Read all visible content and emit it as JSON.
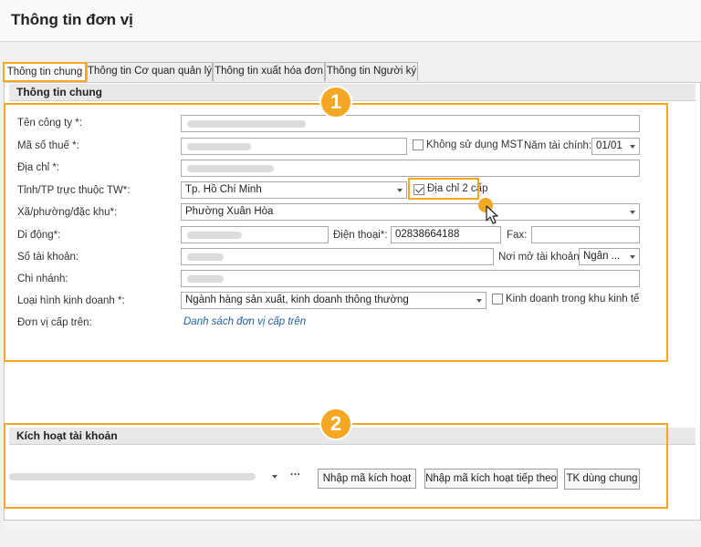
{
  "header": {
    "title": "Thông tin đơn vị"
  },
  "tabs": [
    {
      "label": "Thông tin chung",
      "active": true
    },
    {
      "label": "Thông tin Cơ quan quản lý",
      "active": false
    },
    {
      "label": "Thông tin xuất hóa đơn",
      "active": false
    },
    {
      "label": "Thông tin Người ký",
      "active": false
    }
  ],
  "general": {
    "section_title": "Thông tin chung",
    "company_name_label": "Tên công ty *:",
    "tax_code_label": "Mã số thuế *:",
    "no_tax_code_label": "Không sử dụng MST",
    "fiscal_year_label": "Năm tài chính:",
    "fiscal_year_value": "01/01",
    "address_label": "Địa chỉ *:",
    "province_label": "Tỉnh/TP trực thuộc TW*:",
    "province_value": "Tp. Hồ Chí Minh",
    "two_level_address_label": "Địa chỉ 2 cấp",
    "ward_label": "Xã/phường/đặc khu*:",
    "ward_value": "Phường Xuân Hòa",
    "mobile_label": "Di động*:",
    "phone_label": "Điện thoại*:",
    "phone_value": "02838664188",
    "fax_label": "Fax:",
    "account_no_label": "Số tài khoản:",
    "bank_label": "Nơi mở tài khoản:",
    "bank_value": "Ngân ...",
    "branch_label": "Chi nhánh:",
    "business_type_label": "Loại hình kinh doanh *:",
    "business_type_value": "Ngành hàng sản xuất, kinh doanh thông thường",
    "econ_zone_label": "Kinh doanh trong khu kinh tế",
    "parent_unit_label": "Đơn vị cấp trên:",
    "parent_unit_link": "Danh sách đơn vị cấp trên"
  },
  "activation": {
    "section_title": "Kích hoạt tài khoản",
    "more_label": "···",
    "enter_code_button": "Nhập mã kích hoạt",
    "enter_next_code_button": "Nhập mã kích hoạt tiếp theo",
    "shared_account_button": "TK dùng chung"
  },
  "callouts": {
    "one": "1",
    "two": "2"
  },
  "colors": {
    "highlight": "#f5a623",
    "link": "#1f5fa8"
  }
}
